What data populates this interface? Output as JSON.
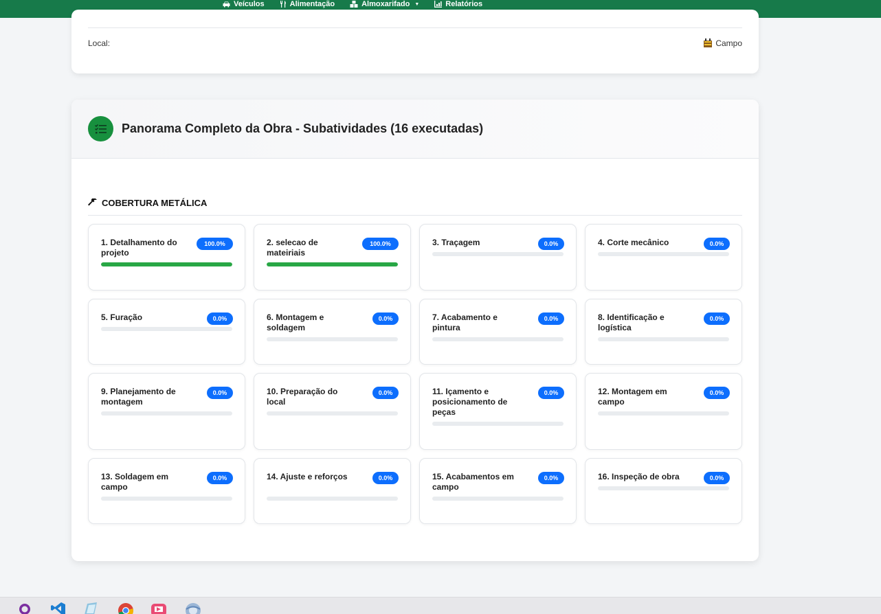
{
  "nav": {
    "items": [
      {
        "label": "Veículos",
        "icon": "car-icon"
      },
      {
        "label": "Alimentação",
        "icon": "utensils-icon"
      },
      {
        "label": "Almoxarifado",
        "icon": "boxes-icon"
      },
      {
        "label": "Relatórios",
        "icon": "chart-icon"
      }
    ]
  },
  "info": {
    "local_label": "Local:",
    "local_value": "Campo",
    "local_icon": "construction-icon"
  },
  "panel": {
    "title": "Panorama Completo da Obra - Subatividades (16 executadas)",
    "icon": "tasks-icon",
    "section": "COBERTURA METÁLICA",
    "section_icon": "hammer-icon"
  },
  "tasks": [
    {
      "name": "1. Detalhamento do projeto",
      "badge": "100.0%",
      "progress": 100
    },
    {
      "name": "2. selecao de mateiriais",
      "badge": "100.0%",
      "progress": 100
    },
    {
      "name": "3. Traçagem",
      "badge": "0.0%",
      "progress": 0
    },
    {
      "name": "4. Corte mecânico",
      "badge": "0.0%",
      "progress": 0
    },
    {
      "name": "5. Furação",
      "badge": "0.0%",
      "progress": 0
    },
    {
      "name": "6. Montagem e soldagem",
      "badge": "0.0%",
      "progress": 0
    },
    {
      "name": "7. Acabamento e pintura",
      "badge": "0.0%",
      "progress": 0
    },
    {
      "name": "8. Identificação e logística",
      "badge": "0.0%",
      "progress": 0
    },
    {
      "name": "9. Planejamento de montagem",
      "badge": "0.0%",
      "progress": 0
    },
    {
      "name": "10. Preparação do local",
      "badge": "0.0%",
      "progress": 0
    },
    {
      "name": "11. Içamento e posicionamento de peças",
      "badge": "0.0%",
      "progress": 0
    },
    {
      "name": "12. Montagem em campo",
      "badge": "0.0%",
      "progress": 0
    },
    {
      "name": "13. Soldagem em campo",
      "badge": "0.0%",
      "progress": 0
    },
    {
      "name": "14. Ajuste e reforços",
      "badge": "0.0%",
      "progress": 0
    },
    {
      "name": "15. Acabamentos em campo",
      "badge": "0.0%",
      "progress": 0
    },
    {
      "name": "16. Inspeção de obra",
      "badge": "0.0%",
      "progress": 0
    }
  ],
  "taskbar": {
    "apps": [
      "search-icon",
      "vscode-icon",
      "notepad-icon",
      "chrome-icon",
      "media-icon",
      "browser-icon"
    ]
  },
  "colors": {
    "nav_bg": "#177a4a",
    "badge": "#0d6efd",
    "progress_fill": "#28a745",
    "header_icon_bg": "#17903e"
  }
}
